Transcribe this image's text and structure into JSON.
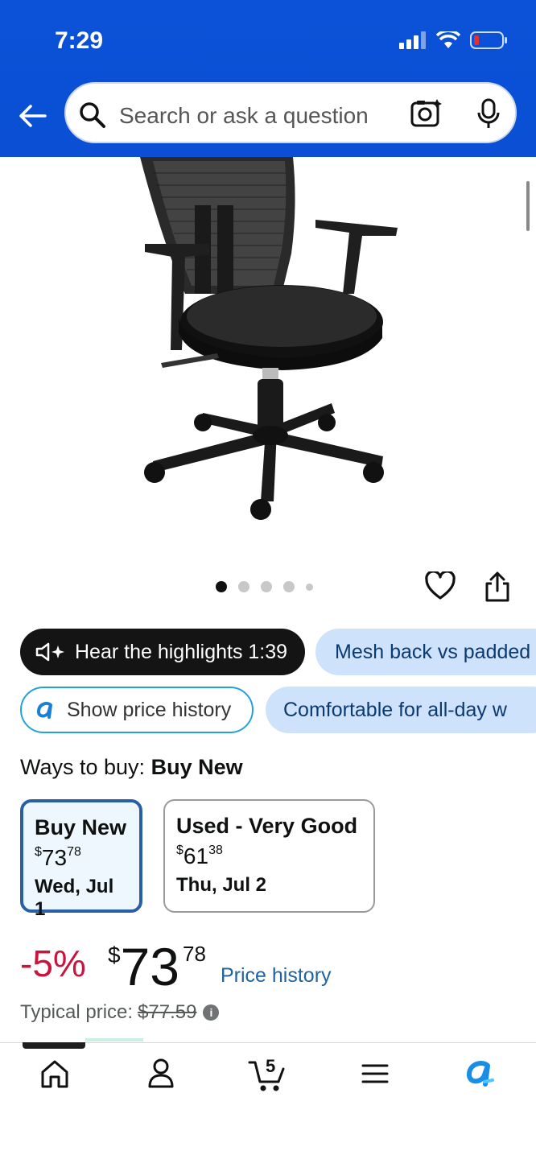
{
  "status_bar": {
    "time": "7:29"
  },
  "search": {
    "placeholder": "Search or ask a question"
  },
  "product": {
    "image_icon": "office-chair-image",
    "image_count": 5,
    "active_image": 1
  },
  "chips": {
    "hear_highlights": "Hear the highlights 1:39",
    "mesh_back": "Mesh back vs padded",
    "show_price_history": "Show price history",
    "comfortable": "Comfortable for all-day w"
  },
  "ways_to_buy": {
    "label": "Ways to buy:",
    "selected": "Buy New"
  },
  "buy_options": [
    {
      "title": "Buy New",
      "currency": "$",
      "whole": "73",
      "fraction": "78",
      "date": "Wed, Jul 1"
    },
    {
      "title": "Used - Very Good",
      "currency": "$",
      "whole": "61",
      "fraction": "38",
      "date": "Thu, Jul 2"
    }
  ],
  "price": {
    "discount": "-5%",
    "currency": "$",
    "whole": "73",
    "fraction": "78",
    "history_link": "Price history",
    "typical_label": "Typical price:",
    "typical_value": "$77.59"
  },
  "tabbar": {
    "items": [
      "home-icon",
      "account-icon",
      "cart-icon",
      "menu-icon",
      "rufus-icon"
    ],
    "cart_count": "5"
  },
  "colors": {
    "header_blue": "#0b52d8",
    "discount_red": "#c7153f",
    "link_blue": "#2162a1",
    "chip_blue": "#cfe2fb"
  }
}
